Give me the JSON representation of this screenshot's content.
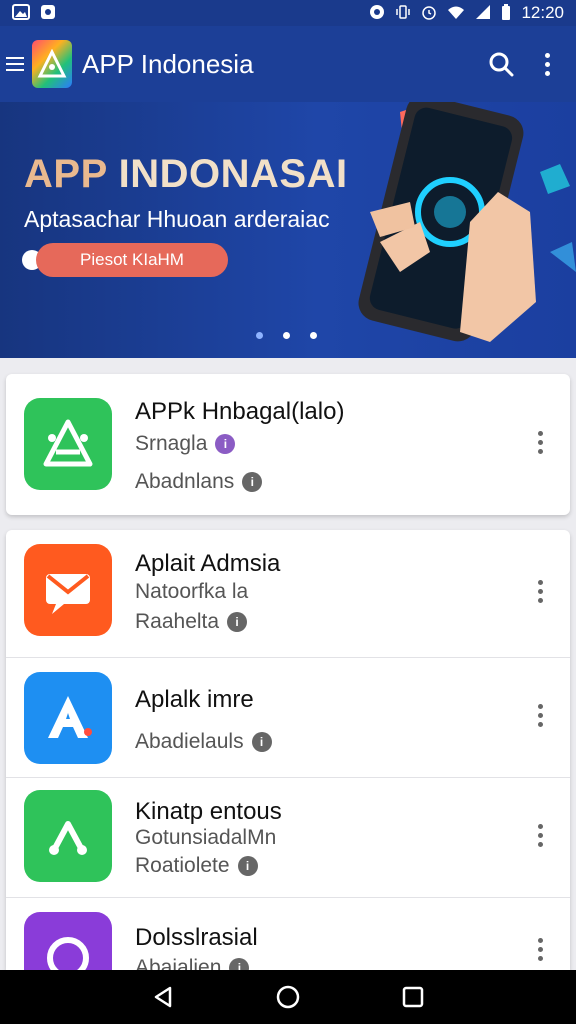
{
  "status_bar": {
    "time": "12:20",
    "left_icons": [
      "image-icon",
      "app-notification-icon"
    ],
    "right_icons": [
      "sync-icon",
      "vibrate-icon",
      "alarm-icon",
      "wifi-icon",
      "signal-icon",
      "battery-icon"
    ]
  },
  "app_bar": {
    "title": "APP Indonesia",
    "logo_icon": "app-logo-icon",
    "brand_gradient": [
      "#ff4d6d",
      "#ffb020",
      "#21c17a",
      "#2b7bff"
    ]
  },
  "banner": {
    "title_part1": "APP ",
    "title_part2": "INDONASAI",
    "subtitle": "Aptasachar Hhuoan arderaiac",
    "cta_label": "Piesot KIaHM",
    "active_slide": 2,
    "slide_count": 3
  },
  "apps": [
    {
      "name": "APPk Hnbagal(lalo)",
      "line1": "Srnagla",
      "line2": "Abadnlans",
      "icon": "triangle-app-icon",
      "color": "#2fc35a",
      "dot1": "purple"
    },
    {
      "name": "Aplait Admsia",
      "line1": "Natoorfka la",
      "line2": "Raahelta",
      "icon": "mail-icon",
      "color": "#ff5a1f"
    },
    {
      "name": "Aplalk imre",
      "line1": "",
      "line2": "Abadielauls",
      "icon": "letter-a-icon",
      "color": "#1e8ff2"
    },
    {
      "name": "Kinatp entous",
      "line1": "GotunsiadalMn",
      "line2": "Roatiolete",
      "icon": "share-icon",
      "color": "#2fc35a"
    },
    {
      "name": "Dolsslrasial",
      "line1": "",
      "line2": "Abaialien",
      "icon": "chat-icon",
      "color": "#8a3cd9"
    }
  ],
  "nav": {
    "back_icon": "back-icon",
    "home_icon": "home-icon",
    "recents_icon": "recents-icon"
  }
}
